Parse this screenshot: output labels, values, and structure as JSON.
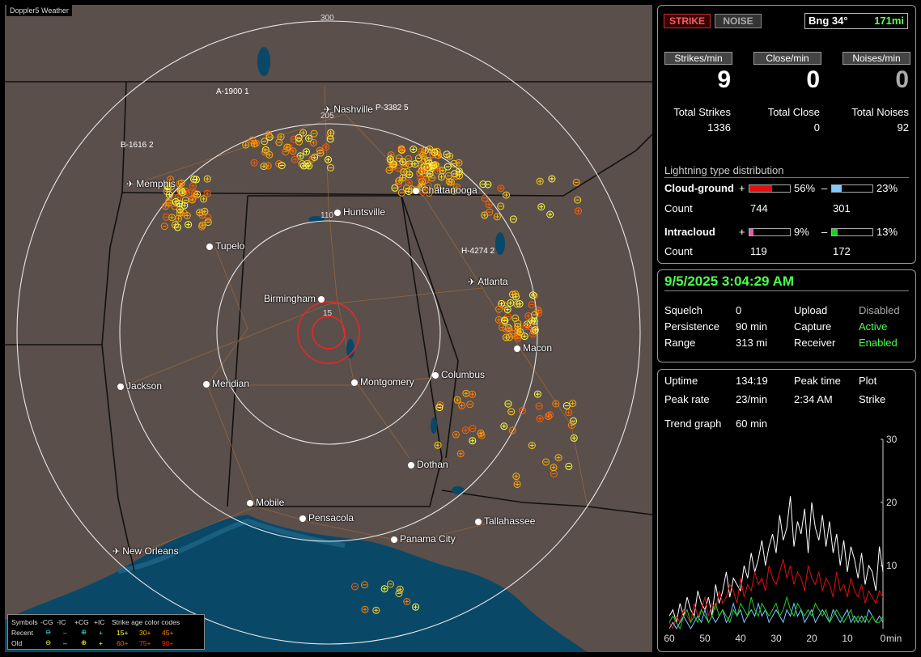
{
  "app": {
    "title": "Doppler5 Weather"
  },
  "map": {
    "ring_labels": [
      "300",
      "205",
      "110",
      "15"
    ],
    "cities": [
      {
        "name": "Nashville",
        "icon": "airplane-icon"
      },
      {
        "name": "Memphis",
        "icon": "airplane-icon"
      },
      {
        "name": "Chattanooga",
        "icon": "dot-icon"
      },
      {
        "name": "Huntsville",
        "icon": "dot-icon"
      },
      {
        "name": "Tupelo",
        "icon": "dot-icon"
      },
      {
        "name": "Atlanta",
        "icon": "airplane-icon"
      },
      {
        "name": "Birmingham",
        "icon": "dot-icon"
      },
      {
        "name": "Macon",
        "icon": "dot-icon"
      },
      {
        "name": "Jackson",
        "icon": "dot-icon"
      },
      {
        "name": "Meridian",
        "icon": "dot-icon"
      },
      {
        "name": "Montgomery",
        "icon": "dot-icon"
      },
      {
        "name": "Columbus",
        "icon": "dot-icon"
      },
      {
        "name": "Dothan",
        "icon": "dot-icon"
      },
      {
        "name": "Mobile",
        "icon": "dot-icon"
      },
      {
        "name": "Pensacola",
        "icon": "dot-icon"
      },
      {
        "name": "Tallahassee",
        "icon": "dot-icon"
      },
      {
        "name": "Panama City",
        "icon": "dot-icon"
      },
      {
        "name": "New Orleans",
        "icon": "airplane-icon"
      }
    ],
    "markers": [
      "A-1900 1",
      "P-3382 5",
      "B-1616 2",
      "H-4274 2"
    ],
    "legend": {
      "col_headers": [
        "Symbols",
        "-CG",
        "-IC",
        "+CG",
        "+IC",
        "Strike age color codes"
      ],
      "recent": {
        "label": "Recent",
        "ages": [
          "15+",
          "30+",
          "45+"
        ]
      },
      "old": {
        "label": "Old",
        "ages": [
          "60+",
          "75+",
          "90+"
        ]
      },
      "colors": {
        "age15": "#ffff40",
        "age30": "#ffb000",
        "age45": "#ff8000",
        "age60": "#ff6000",
        "age75": "#ff4000",
        "age90": "#ff2000",
        "recent_symbol": "#40e0e0"
      }
    }
  },
  "status": {
    "strike_button": "STRIKE",
    "noise_button": "NOISE",
    "bearing": "Bng 34°",
    "range": "171mi",
    "rates": [
      {
        "label": "Strikes/min",
        "value": "9"
      },
      {
        "label": "Close/min",
        "value": "0"
      },
      {
        "label": "Noises/min",
        "value": "0"
      }
    ],
    "totals": [
      {
        "label": "Total Strikes",
        "value": "1336"
      },
      {
        "label": "Total Close",
        "value": "0"
      },
      {
        "label": "Total Noises",
        "value": "92"
      }
    ],
    "distribution": {
      "title": "Lightning type distribution",
      "cloud_ground": {
        "label": "Cloud-ground",
        "pos_sign": "+",
        "pos_pct": "56%",
        "pos_fill": 0.56,
        "neg_sign": "–",
        "neg_pct": "23%",
        "neg_fill": 0.23,
        "count_label": "Count",
        "pos_count": "744",
        "neg_count": "301"
      },
      "intracloud": {
        "label": "Intracloud",
        "pos_sign": "+",
        "pos_pct": "9%",
        "pos_fill": 0.09,
        "neg_sign": "–",
        "neg_pct": "13%",
        "neg_fill": 0.13,
        "count_label": "Count",
        "pos_count": "119",
        "neg_count": "172"
      },
      "colors": {
        "cg_pos": "#e01010",
        "cg_neg": "#80c8ff",
        "ic_pos": "#e060a0",
        "ic_neg": "#20d020"
      }
    }
  },
  "settings": {
    "datetime": "9/5/2025 3:04:29 AM",
    "rows": [
      {
        "k1": "Squelch",
        "v1": "0",
        "k2": "Upload",
        "v2": "Disabled"
      },
      {
        "k1": "Persistence",
        "v1": "90 min",
        "k2": "Capture",
        "v2": "Active"
      },
      {
        "k1": "Range",
        "v1": "313 mi",
        "k2": "Receiver",
        "v2": "Enabled"
      }
    ]
  },
  "stats": {
    "uptime_label": "Uptime",
    "uptime": "134:19",
    "peak_time_label": "Peak time",
    "plot_label": "Plot",
    "peak_rate_label": "Peak rate",
    "peak_rate": "23/min",
    "peak_time": "2:34 AM",
    "plot": "Strike",
    "trend_label": "Trend graph",
    "trend_window": "60 min"
  },
  "chart_data": {
    "type": "line",
    "title": "",
    "xlabel": "min",
    "ylabel": "",
    "x_ticks": [
      "60",
      "50",
      "40",
      "30",
      "20",
      "10",
      "0"
    ],
    "y_ticks": [
      "10",
      "20",
      "30"
    ],
    "xlim": [
      60,
      0
    ],
    "ylim": [
      0,
      30
    ],
    "series": [
      {
        "color": "#ffffff",
        "values": [
          2,
          3,
          1,
          4,
          2,
          5,
          3,
          2,
          6,
          4,
          3,
          5,
          2,
          7,
          4,
          6,
          9,
          5,
          8,
          7,
          6,
          10,
          8,
          12,
          9,
          11,
          14,
          10,
          13,
          15,
          12,
          18,
          14,
          16,
          21,
          13,
          17,
          15,
          19,
          12,
          20,
          16,
          14,
          18,
          13,
          17,
          12,
          15,
          10,
          14,
          9,
          13,
          11,
          8,
          12,
          7,
          10,
          9,
          6,
          13,
          9
        ]
      },
      {
        "color": "#e01010",
        "values": [
          1,
          0,
          2,
          1,
          3,
          2,
          1,
          4,
          2,
          3,
          5,
          2,
          4,
          3,
          6,
          4,
          5,
          7,
          6,
          4,
          8,
          5,
          7,
          6,
          9,
          7,
          8,
          6,
          10,
          8,
          7,
          9,
          11,
          8,
          10,
          7,
          9,
          8,
          6,
          10,
          8,
          7,
          9,
          6,
          8,
          7,
          5,
          9,
          6,
          7,
          5,
          8,
          6,
          5,
          7,
          4,
          6,
          5,
          4,
          6,
          5
        ]
      },
      {
        "color": "#80c8ff",
        "values": [
          0,
          1,
          0,
          1,
          2,
          1,
          0,
          1,
          2,
          1,
          3,
          1,
          2,
          1,
          2,
          3,
          1,
          2,
          4,
          2,
          3,
          1,
          2,
          3,
          2,
          4,
          2,
          3,
          1,
          2,
          3,
          2,
          1,
          3,
          2,
          4,
          2,
          3,
          1,
          2,
          3,
          1,
          2,
          3,
          2,
          1,
          3,
          2,
          1,
          2,
          3,
          1,
          2,
          1,
          2,
          1,
          3,
          2,
          1,
          2,
          1
        ]
      },
      {
        "color": "#20d020",
        "values": [
          1,
          2,
          1,
          0,
          2,
          3,
          1,
          2,
          1,
          3,
          2,
          1,
          2,
          4,
          2,
          3,
          2,
          1,
          3,
          2,
          4,
          3,
          2,
          5,
          3,
          2,
          4,
          3,
          2,
          3,
          4,
          2,
          3,
          5,
          3,
          2,
          4,
          3,
          2,
          3,
          2,
          4,
          3,
          2,
          3,
          1,
          2,
          3,
          2,
          1,
          2,
          3,
          1,
          2,
          1,
          2,
          1,
          2,
          1,
          1,
          2
        ]
      }
    ]
  }
}
